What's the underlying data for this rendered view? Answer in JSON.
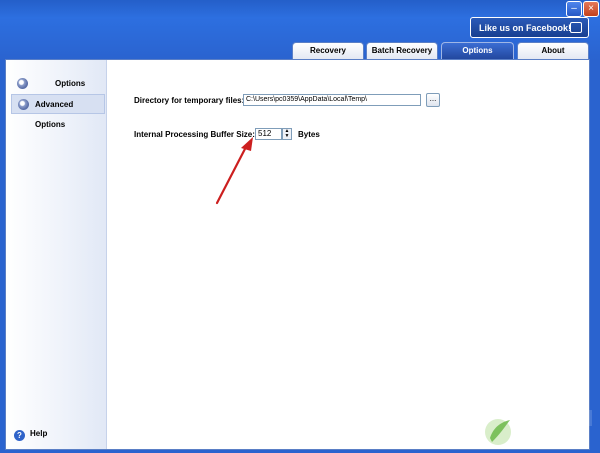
{
  "titlebar": {
    "minimize_glyph": "–",
    "close_glyph": "×"
  },
  "facebook": {
    "label": "Like us on Facebook!"
  },
  "tabs": [
    {
      "label": "Recovery"
    },
    {
      "label": "Batch Recovery"
    },
    {
      "label": "Options"
    },
    {
      "label": "About"
    }
  ],
  "sidebar": {
    "items": [
      {
        "label": "Options"
      },
      {
        "label": "Advanced Options"
      }
    ],
    "help_label": "Help"
  },
  "settings": {
    "temp_dir_label": "Directory for temporary files:",
    "temp_dir_value": "C:\\Users\\pc0359\\AppData\\Local\\Temp\\",
    "browse_label": "...",
    "buffer_label": "Internal Processing Buffer Size:",
    "buffer_value": "512",
    "buffer_unit": "Bytes"
  },
  "colors": {
    "titlebar_blue": "#2d6fe0",
    "active_tab": "#23489f",
    "arrow_red": "#cc1f1f"
  },
  "icons": {
    "facebook_thumb": "thumbs-up-icon",
    "sidebar_item": "gear-disc-icon",
    "help": "help-icon"
  }
}
